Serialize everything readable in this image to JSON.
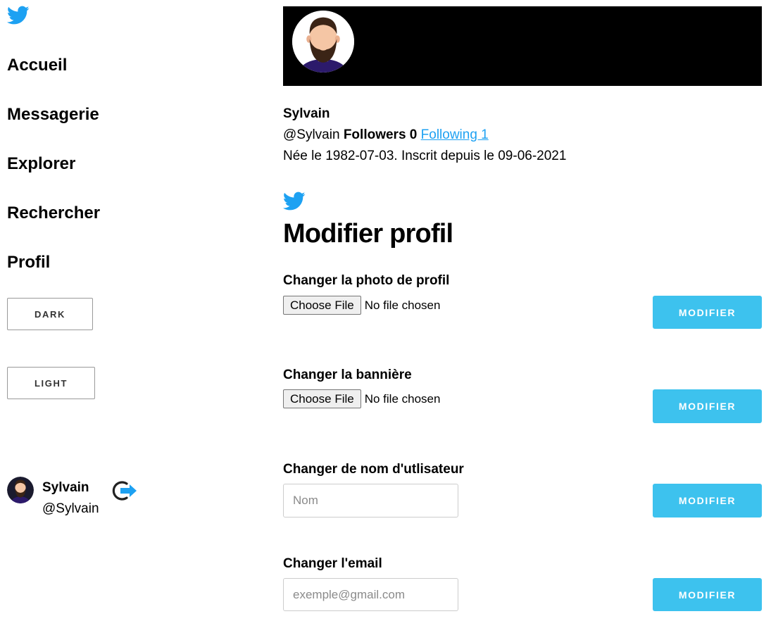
{
  "colors": {
    "twitter_blue": "#1da1f2",
    "button_blue": "#3dc2ee",
    "banner": "#000000"
  },
  "icons": {
    "logo": "twitter-bird-icon",
    "logout": "logout-arrow-icon"
  },
  "sidebar": {
    "nav": [
      {
        "label": "Accueil"
      },
      {
        "label": "Messagerie"
      },
      {
        "label": "Explorer"
      },
      {
        "label": "Rechercher"
      },
      {
        "label": "Profil"
      }
    ],
    "dark_label": "DARK",
    "light_label": "LIGHT",
    "user": {
      "name": "Sylvain",
      "handle": "@Sylvain"
    }
  },
  "profile": {
    "name": "Sylvain",
    "handle": "@Sylvain",
    "followers_label": "Followers 0",
    "following_label": "Following 1",
    "dates": "Née le 1982-07-03. Inscrit depuis le 09-06-2021"
  },
  "edit": {
    "title": "Modifier profil",
    "photo": {
      "label": "Changer la photo de profil",
      "choose": "Choose File",
      "status": "No file chosen",
      "button": "MODIFIER"
    },
    "banner": {
      "label": "Changer la bannière",
      "choose": "Choose File",
      "status": "No file chosen",
      "button": "MODIFIER"
    },
    "username": {
      "label": "Changer de nom d'utlisateur",
      "placeholder": "Nom",
      "value": "",
      "button": "MODIFIER"
    },
    "email": {
      "label": "Changer l'email",
      "placeholder": "exemple@gmail.com",
      "value": "",
      "button": "MODIFIER"
    }
  }
}
